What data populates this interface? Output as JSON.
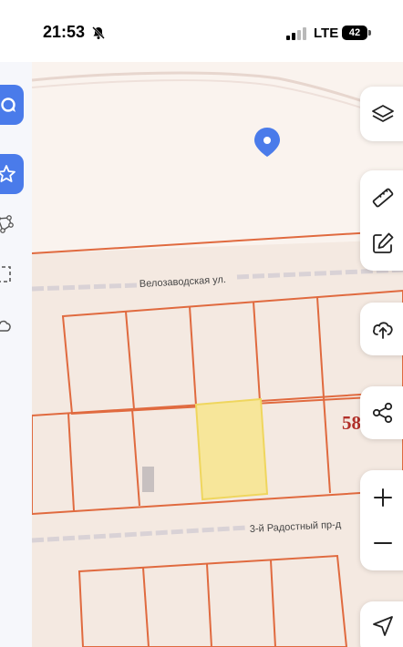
{
  "status_bar": {
    "time": "21:53",
    "network": "LTE",
    "battery": "42"
  },
  "map": {
    "street_labels": [
      "Велозаводская ул.",
      "3-й Радостный пр-д"
    ],
    "parcel_number": "58"
  },
  "icons": {
    "left": [
      "chat-bubble-icon",
      "star-icon",
      "polygon-nodes-icon",
      "dashed-select-icon",
      "cloud-icon"
    ],
    "right": [
      "layers-icon",
      "ruler-icon",
      "edit-icon",
      "upload-cloud-icon",
      "share-icon",
      "zoom-in-icon",
      "zoom-out-icon",
      "navigate-icon"
    ]
  },
  "colors": {
    "accent": "#4a7bea",
    "parcel_border": "#e06a3f",
    "selected_parcel": "#f7e69a",
    "map_background": "#f4e9e1"
  }
}
